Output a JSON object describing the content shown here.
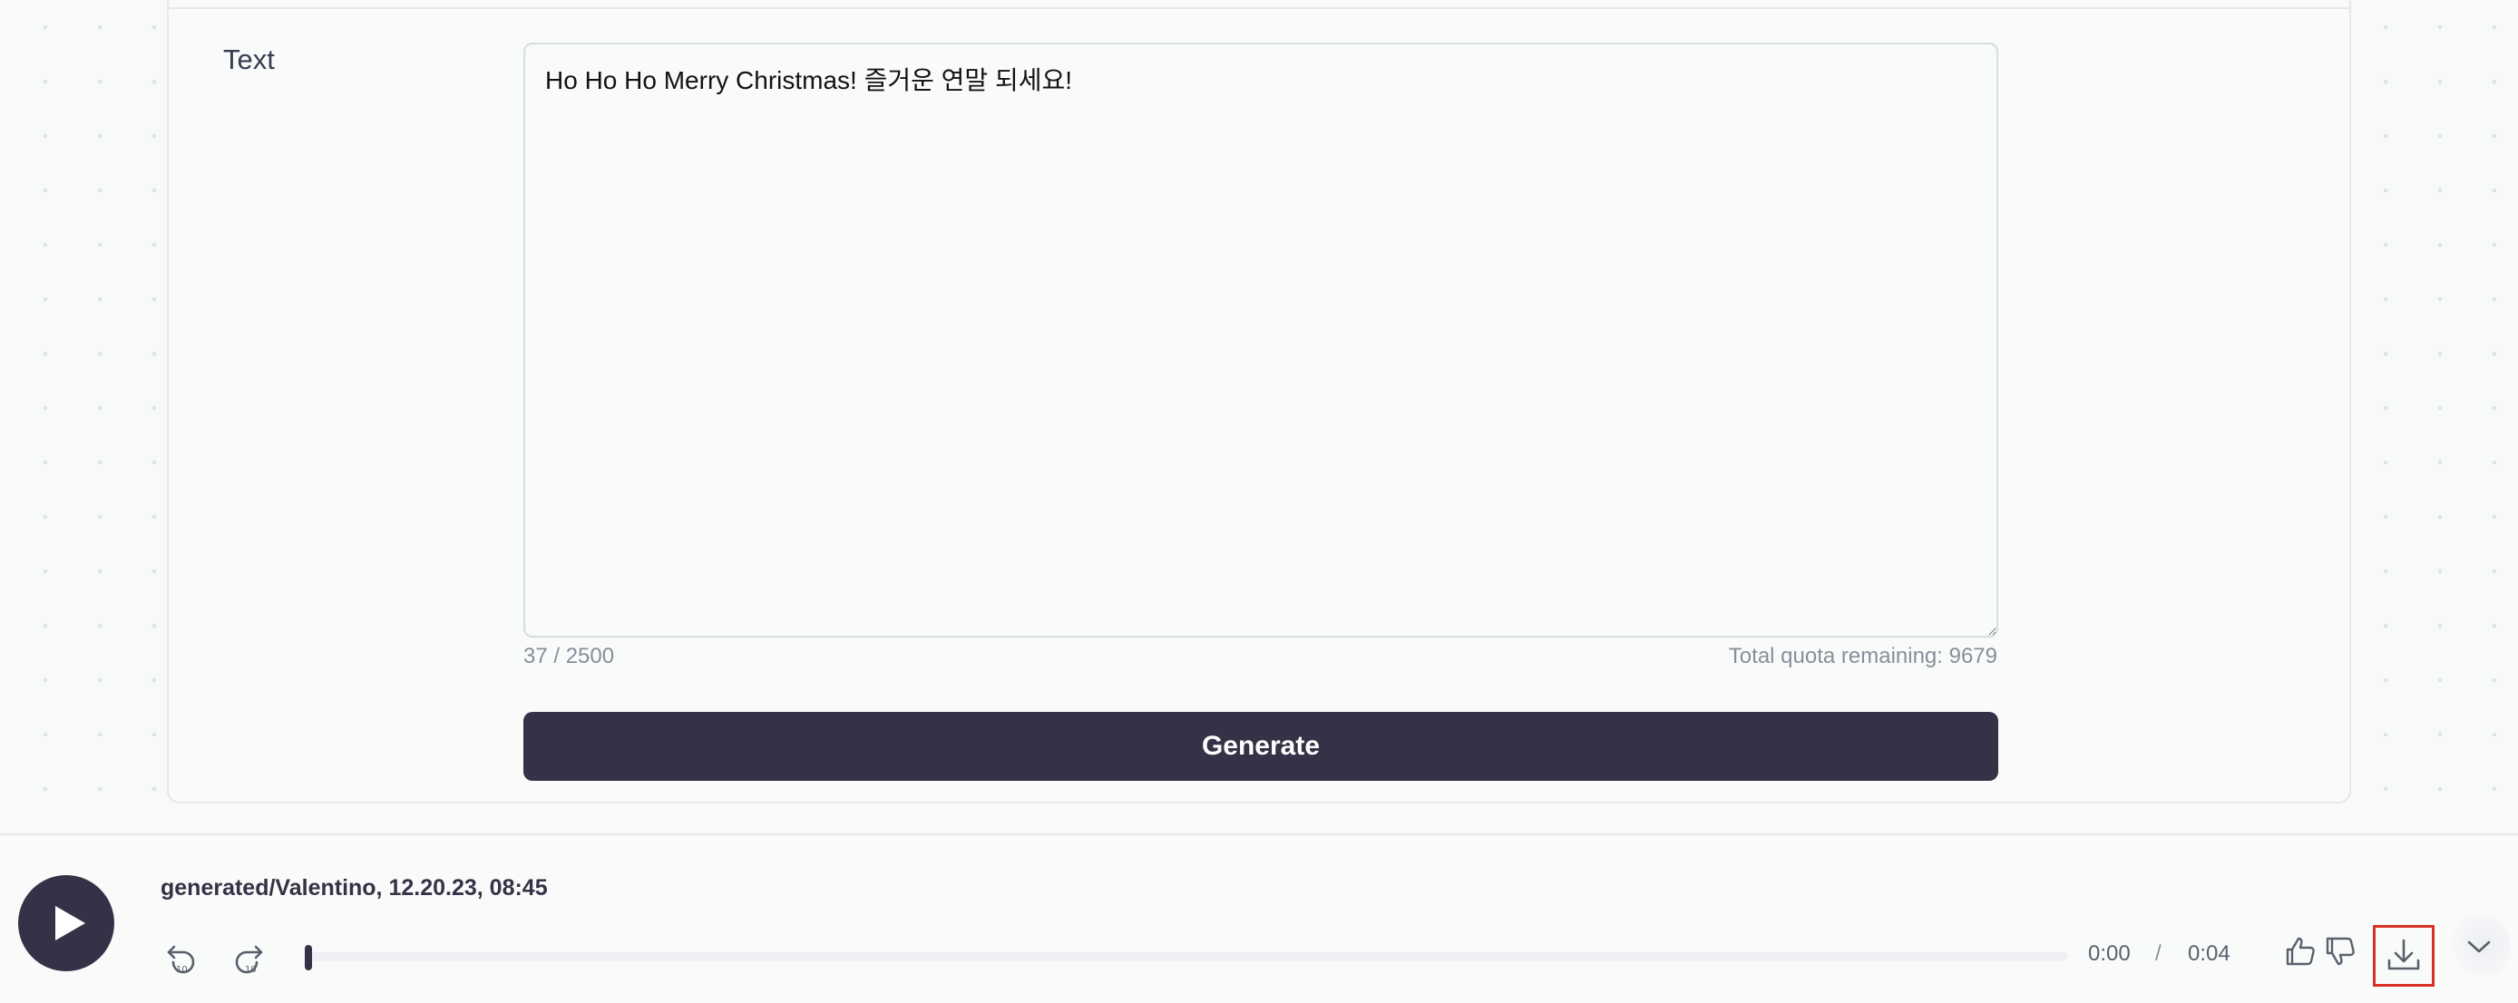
{
  "form": {
    "text_label": "Text",
    "text_value": "Ho Ho Ho Merry Christmas! 즐거운 연말 되세요!",
    "char_count": "37 / 2500",
    "quota": "Total quota remaining: 9679",
    "generate_label": "Generate"
  },
  "player": {
    "track_title": "generated/Valentino, 12.20.23, 08:45",
    "current_time": "0:00",
    "separator": "/",
    "total_time": "0:04",
    "progress_fraction": 0,
    "icons": {
      "play": "play-icon",
      "skip_back": "rewind-10-icon",
      "skip_forward": "forward-10-icon",
      "like": "thumbs-up-icon",
      "dislike": "thumbs-down-icon",
      "download": "download-icon",
      "expand": "chevron-down-icon"
    }
  },
  "colors": {
    "primary": "#343246",
    "highlight_outline": "#d93025",
    "muted_text": "#8a8d99"
  }
}
